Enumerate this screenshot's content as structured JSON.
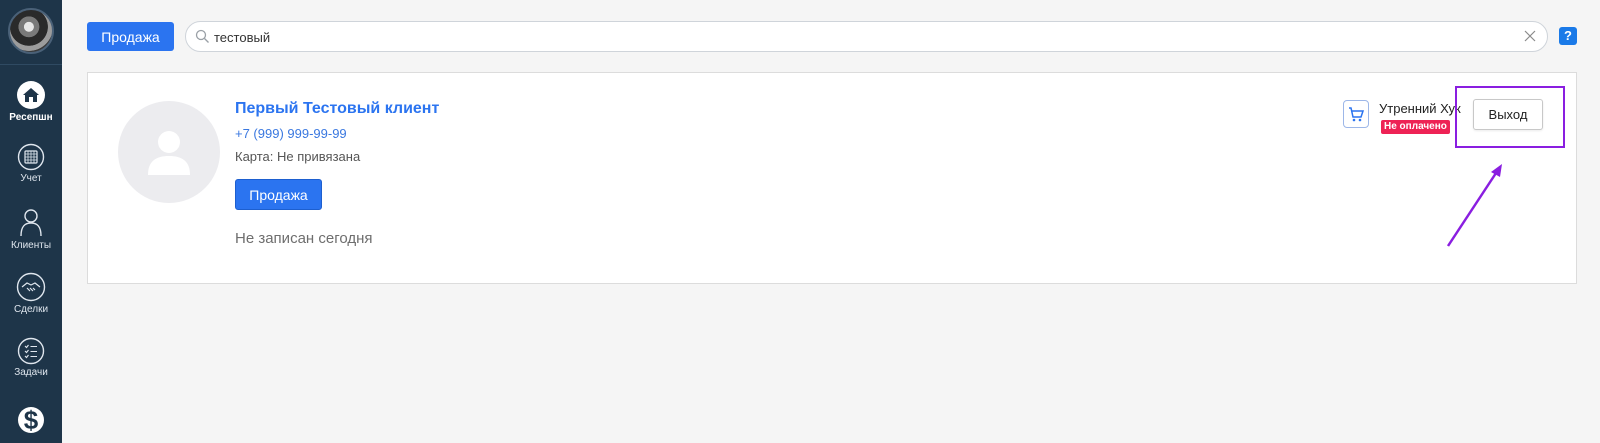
{
  "sidebar": {
    "items": [
      {
        "label": "Ресепшн",
        "icon": "home-icon"
      },
      {
        "label": "Учет",
        "icon": "calendar-icon"
      },
      {
        "label": "Клиенты",
        "icon": "clients-icon"
      },
      {
        "label": "Сделки",
        "icon": "handshake-icon"
      },
      {
        "label": "Задачи",
        "icon": "tasks-icon"
      },
      {
        "label": "",
        "icon": "dollar-icon"
      }
    ]
  },
  "toolbar": {
    "sale_label": "Продажа",
    "search_value": "тестовый",
    "help_label": "?"
  },
  "client": {
    "name": "Первый Тестовый клиент",
    "phone": "+7 (999) 999-99-99",
    "card": "Карта: Не привязана",
    "sale_label": "Продажа",
    "status": "Не записан сегодня"
  },
  "session": {
    "name": "Утренний Хук",
    "badge": "Не оплачено",
    "exit_label": "Выход"
  },
  "colors": {
    "sidebar": "#1e3549",
    "accent": "#2b74f0",
    "unpaid": "#ee2255",
    "annotation": "#8a1ee0"
  }
}
